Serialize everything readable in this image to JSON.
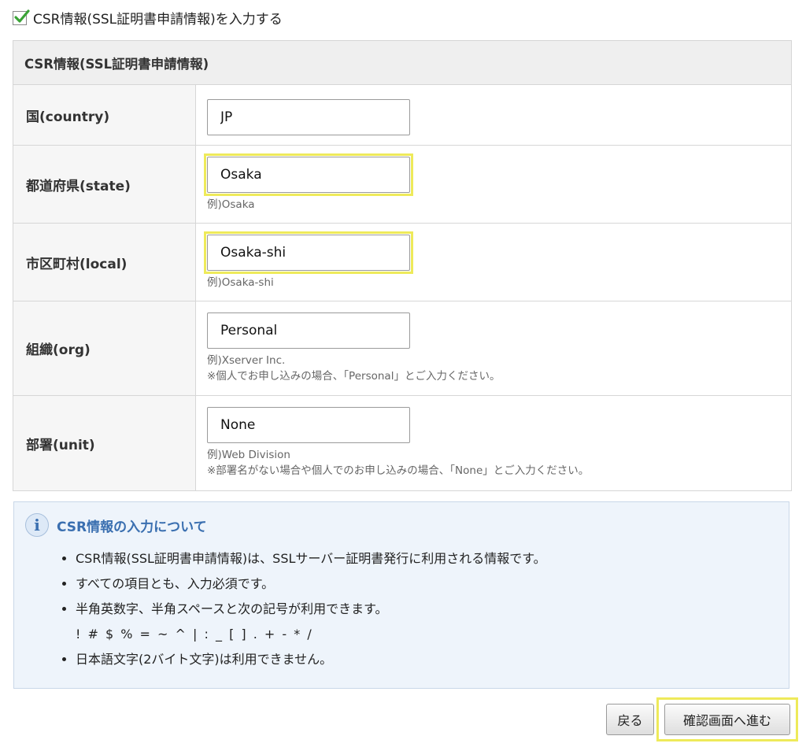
{
  "checkbox": {
    "label": "CSR情報(SSL証明書申請情報)を入力する",
    "checked": true
  },
  "form": {
    "heading": "CSR情報(SSL証明書申請情報)",
    "rows": [
      {
        "label": "国(country)",
        "value": "JP",
        "hints": []
      },
      {
        "label": "都道府県(state)",
        "value": "Osaka",
        "hints": [
          "例)Osaka"
        ]
      },
      {
        "label": "市区町村(local)",
        "value": "Osaka-shi",
        "hints": [
          "例)Osaka-shi"
        ]
      },
      {
        "label": "組織(org)",
        "value": "Personal",
        "hints": [
          "例)Xserver Inc.",
          "※個人でお申し込みの場合、「Personal」とご入力ください。"
        ]
      },
      {
        "label": "部署(unit)",
        "value": "None",
        "hints": [
          "例)Web Division",
          "※部署名がない場合や個人でのお申し込みの場合、「None」とご入力ください。"
        ]
      }
    ]
  },
  "info": {
    "icon": "info-icon",
    "icon_glyph": "i",
    "title": "CSR情報の入力について",
    "items": [
      "CSR情報(SSL証明書申請情報)は、SSLサーバー証明書発行に利用される情報です。",
      "すべての項目とも、入力必須です。",
      "半角英数字、半角スペースと次の記号が利用できます。",
      "日本語文字(2バイト文字)は利用できません。"
    ],
    "symbols": "! # $ % = ~ ^ | : _ [ ] . + - * /"
  },
  "buttons": {
    "back": "戻る",
    "next": "確認画面へ進む"
  },
  "colors": {
    "highlight": "#eeea5a",
    "check": "#3aa336",
    "info_title": "#3a6fb0"
  }
}
